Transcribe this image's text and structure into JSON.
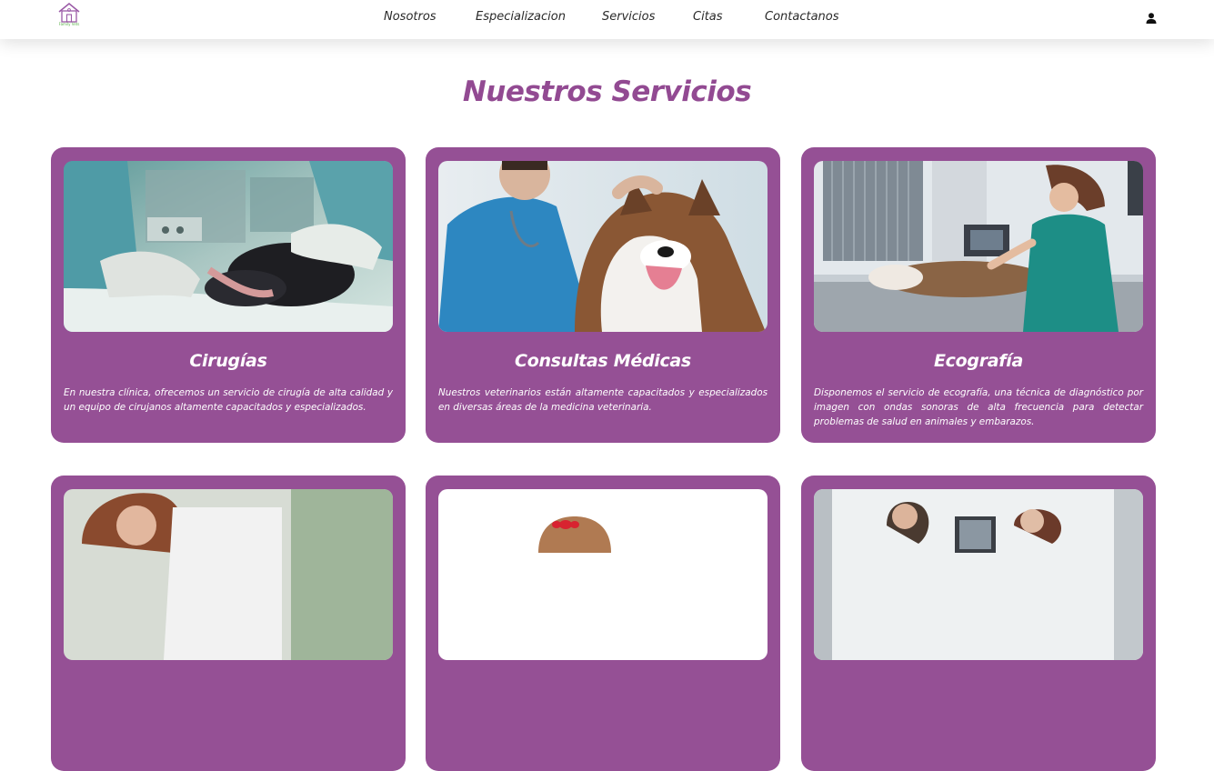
{
  "nav": {
    "logo_alt": "Family Vets",
    "logo_text": "Family Vets",
    "items": [
      "Nosotros",
      "Especializacion",
      "Servicios",
      "Citas",
      "Contactanos"
    ],
    "user_icon": "user-icon"
  },
  "section_title": "Nuestros Servicios",
  "colors": {
    "brand_purple": "#955095",
    "title_purple": "#924a92",
    "logo_green": "#5bb14a"
  },
  "cards": [
    {
      "title": "Cirugías",
      "text": "En nuestra clínica, ofrecemos un servicio de cirugía de alta calidad y un equipo de cirujanos altamente capacitados y especializados."
    },
    {
      "title": "Consultas Médicas",
      "text": "Nuestros veterinarios están altamente capacitados y especializados en diversas áreas de la medicina veterinaria."
    },
    {
      "title": "Ecografía",
      "text": "Disponemos el servicio de ecografía, una técnica de diagnóstico por imagen con ondas sonoras de alta frecuencia para detectar problemas de salud en animales y embarazos."
    }
  ]
}
